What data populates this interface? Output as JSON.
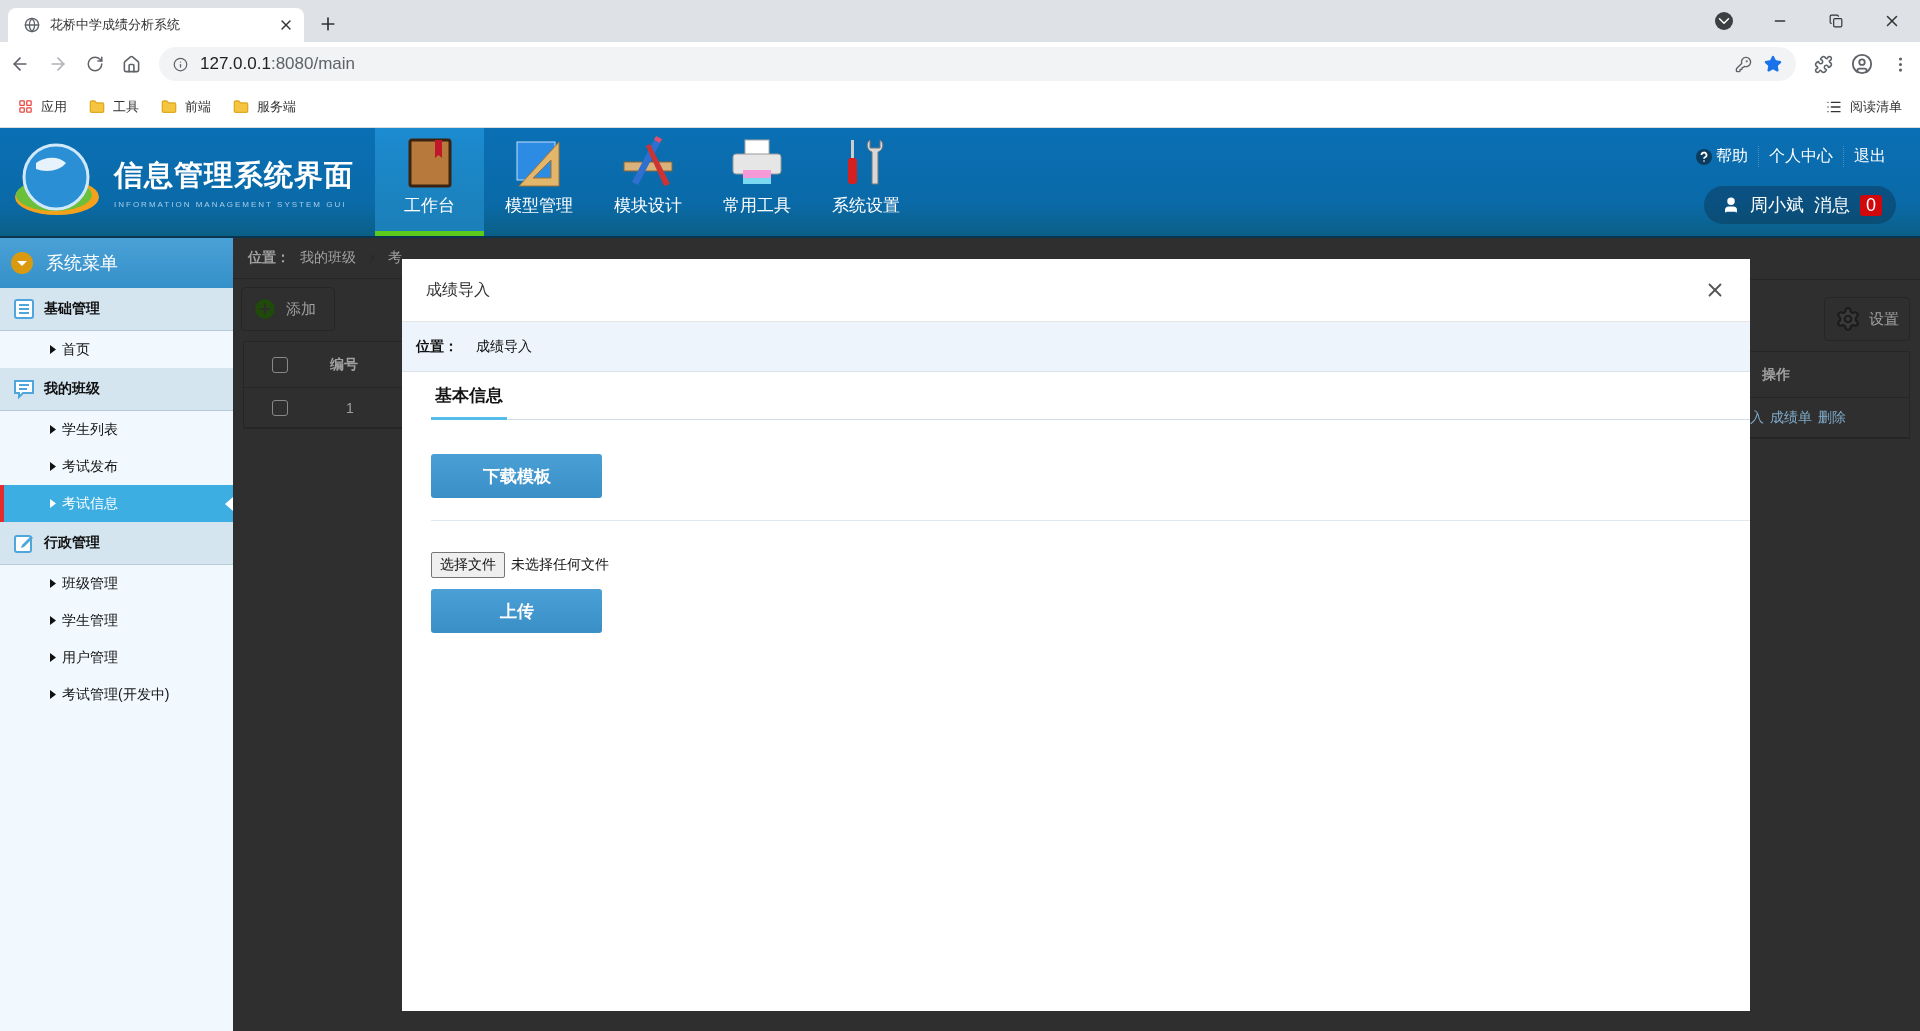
{
  "browser": {
    "tab_title": "花桥中学成绩分析系统",
    "url_host": "127.0.0.1",
    "url_rest": ":8080/main",
    "bookmarks": [
      {
        "label": "应用",
        "kind": "apps"
      },
      {
        "label": "工具",
        "kind": "folder"
      },
      {
        "label": "前端",
        "kind": "folder"
      },
      {
        "label": "服务端",
        "kind": "folder"
      }
    ],
    "reading_list": "阅读清单"
  },
  "header": {
    "logo_title": "信息管理系统界面",
    "logo_subtitle": "INFORMATION MANAGEMENT SYSTEM GUI",
    "nav": [
      {
        "label": "工作台",
        "kind": "book",
        "selected": true
      },
      {
        "label": "模型管理",
        "kind": "ruler",
        "selected": false
      },
      {
        "label": "模块设计",
        "kind": "design",
        "selected": false
      },
      {
        "label": "常用工具",
        "kind": "printer",
        "selected": false
      },
      {
        "label": "系统设置",
        "kind": "tools",
        "selected": false
      }
    ],
    "links": [
      "帮助",
      "个人中心",
      "退出"
    ],
    "user": "周小斌",
    "messages_label": "消息",
    "message_count": "0"
  },
  "sidebar": {
    "title": "系统菜单",
    "groups": [
      {
        "label": "基础管理",
        "kind": "list",
        "items": [
          {
            "label": "首页",
            "selected": false
          }
        ]
      },
      {
        "label": "我的班级",
        "kind": "chat",
        "items": [
          {
            "label": "学生列表",
            "selected": false
          },
          {
            "label": "考试发布",
            "selected": false
          },
          {
            "label": "考试信息",
            "selected": true
          }
        ]
      },
      {
        "label": "行政管理",
        "kind": "edit",
        "items": [
          {
            "label": "班级管理",
            "selected": false
          },
          {
            "label": "学生管理",
            "selected": false
          },
          {
            "label": "用户管理",
            "selected": false
          },
          {
            "label": "考试管理(开发中)",
            "selected": false
          }
        ]
      }
    ]
  },
  "page": {
    "breadcrumb_label": "位置：",
    "breadcrumb": [
      "我的班级",
      "考"
    ],
    "add_button": "添加",
    "settings_button": "设置",
    "columns": [
      "编号",
      "操作"
    ],
    "all_checked": false,
    "rows": [
      {
        "checked": false,
        "id": "1",
        "ops": [
          "入",
          "成绩单",
          "删除"
        ]
      }
    ]
  },
  "dialog": {
    "title": "成绩导入",
    "location_label": "位置：",
    "location": "成绩导入",
    "tab": "基本信息",
    "download_button": "下载模板",
    "file_button": "选择文件",
    "file_status": "未选择任何文件",
    "upload_button": "上传"
  }
}
